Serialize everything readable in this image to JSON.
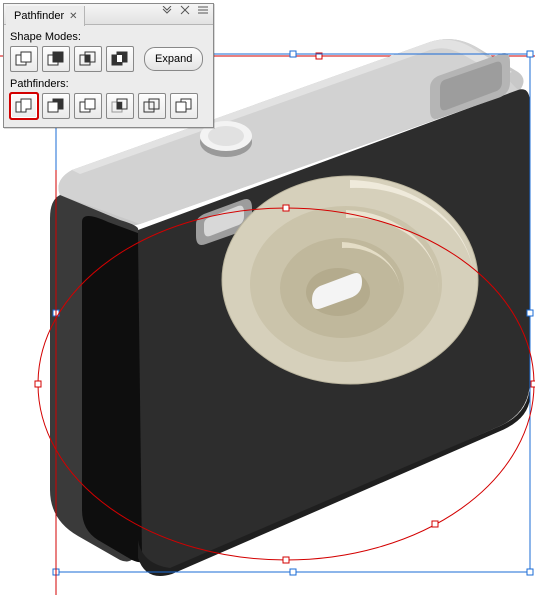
{
  "panel": {
    "title": "Pathfinder",
    "section1_label": "Shape Modes:",
    "section2_label": "Pathfinders:",
    "expand_label": "Expand",
    "shape_modes": [
      {
        "name": "add-to-shape-area",
        "selected": false
      },
      {
        "name": "subtract-from-shape-area",
        "selected": false
      },
      {
        "name": "intersect-shape-areas",
        "selected": false
      },
      {
        "name": "exclude-overlapping-shape-areas",
        "selected": false
      }
    ],
    "pathfinders": [
      {
        "name": "divide",
        "selected": true
      },
      {
        "name": "trim",
        "selected": false
      },
      {
        "name": "merge",
        "selected": false
      },
      {
        "name": "crop",
        "selected": false
      },
      {
        "name": "outline",
        "selected": false
      },
      {
        "name": "minus-back",
        "selected": false
      }
    ]
  },
  "canvas": {
    "subject": "isometric-camera-illustration",
    "selection": "front-face-path-with-ellipse",
    "guide_color": "#d30000",
    "selection_color": "#1a6bd6",
    "camera_colors": {
      "body_front": "#2d2d2d",
      "body_top": "#cfcfcf",
      "body_side": "#4a4a4a",
      "grip": "#0e0e0e",
      "lens_ring": "#e9e4d2",
      "lens_inner": "#dcd6c0"
    }
  }
}
